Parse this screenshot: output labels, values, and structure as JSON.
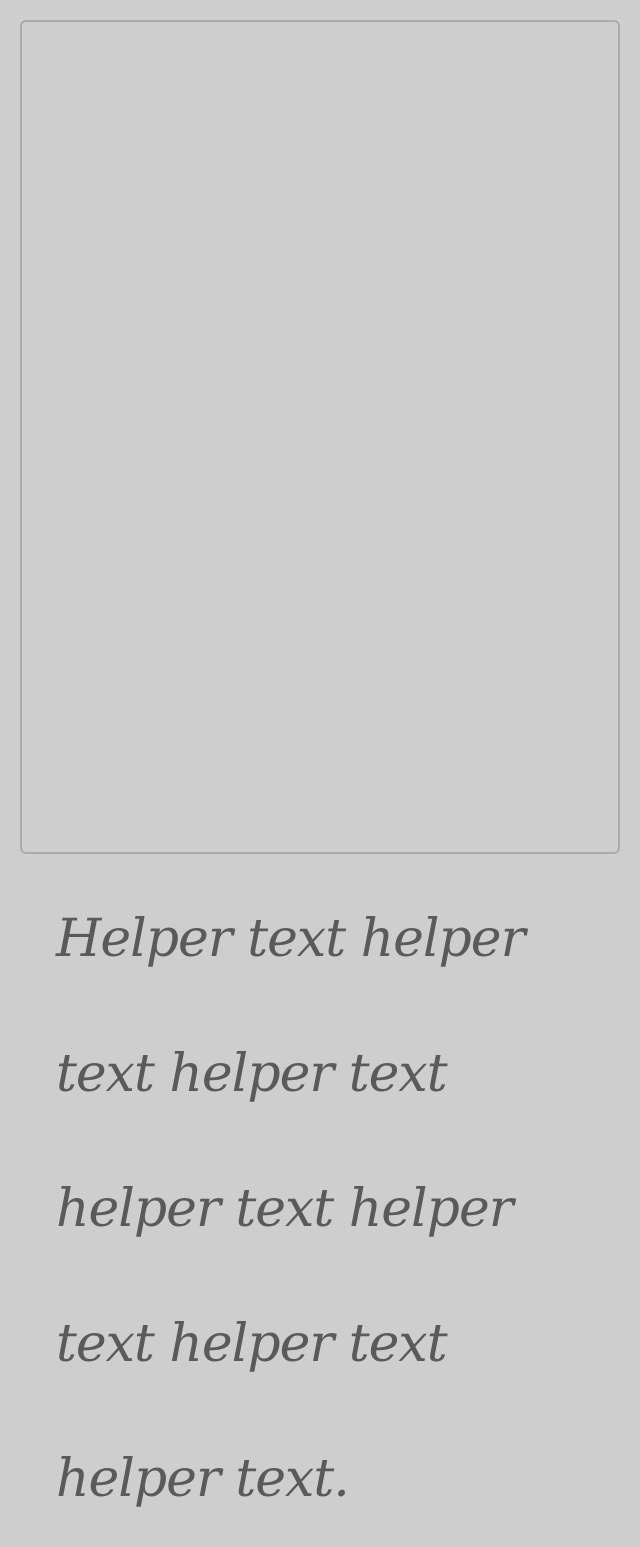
{
  "textarea": {
    "value": ""
  },
  "helper": {
    "text": "Helper text helper text helper text helper text helper text helper text helper text."
  }
}
